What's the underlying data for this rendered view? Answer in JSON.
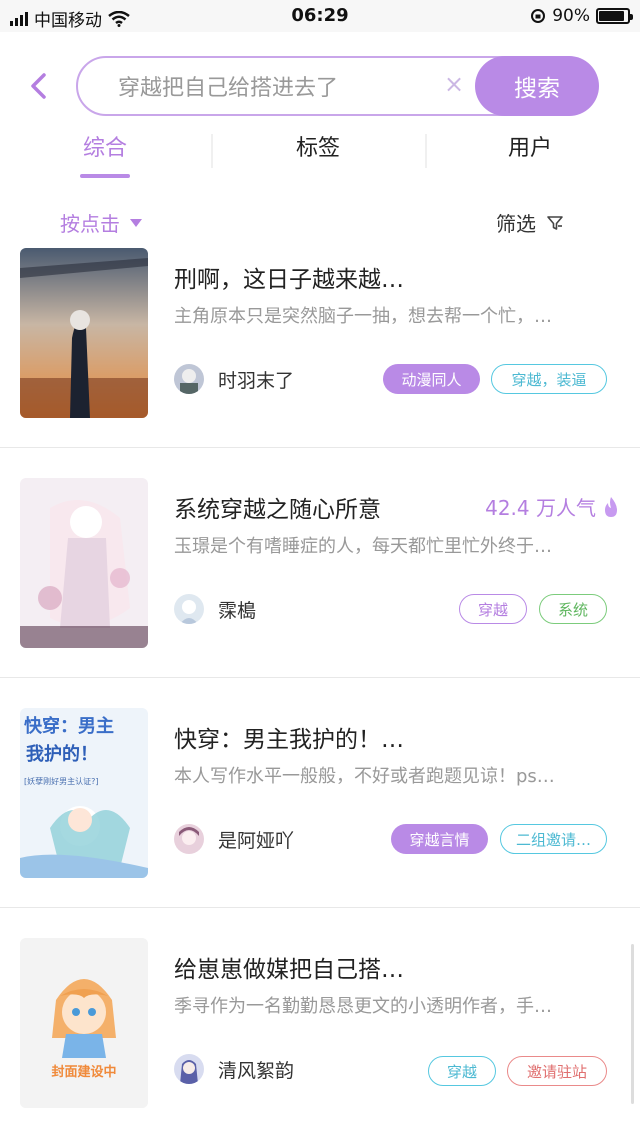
{
  "status_bar": {
    "carrier": "中国移动",
    "time": "06:29",
    "battery": "90%"
  },
  "search": {
    "value": "穿越把自己给搭进去了",
    "clear_glyph": "×",
    "button_label": "搜索"
  },
  "tabs": [
    {
      "label": "综合",
      "active": true
    },
    {
      "label": "标签"
    },
    {
      "label": "用户"
    }
  ],
  "filter_bar": {
    "sort_label": "按点击",
    "filter_label": "筛选"
  },
  "results": [
    {
      "title": "刑啊，这日子越来越…",
      "popularity": "",
      "desc": "主角原本只是突然脑子一抽，想去帮一个忙，…",
      "author": "时羽末了",
      "tags": [
        "动漫同人",
        "穿越，装逼"
      ]
    },
    {
      "title": "系统穿越之随心所意",
      "popularity": "42.4 万人气",
      "desc": "玉璟是个有嗜睡症的人，每天都忙里忙外终于…",
      "author": "霂槝",
      "tags": [
        "穿越",
        "系统"
      ]
    },
    {
      "title": "快穿：男主我护的！…",
      "popularity": "",
      "desc": "本人写作水平一般般，不好或者跑题见谅！ps…",
      "author": "是阿娅吖",
      "tags": [
        "穿越言情",
        "二组邀请…"
      ],
      "cover_text": {
        "line1": "快穿：男主",
        "line2": "我护的！",
        "line3": "[妖孽刚好男主认证?]"
      }
    },
    {
      "title": "给崽崽做媒把自己搭…",
      "popularity": "",
      "desc": "季寻作为一名勤勤恳恳更文的小透明作者，手…",
      "author": "清风絮韵",
      "tags": [
        "穿越",
        "邀请驻站"
      ],
      "cover_text": {
        "placeholder": "封面建设中"
      }
    }
  ],
  "colors": {
    "accent": "#b98ae6",
    "accent_text": "#b47ee0",
    "cyan": "#56c8e0",
    "green": "#7ccc7c",
    "red": "#ea8a8a"
  }
}
